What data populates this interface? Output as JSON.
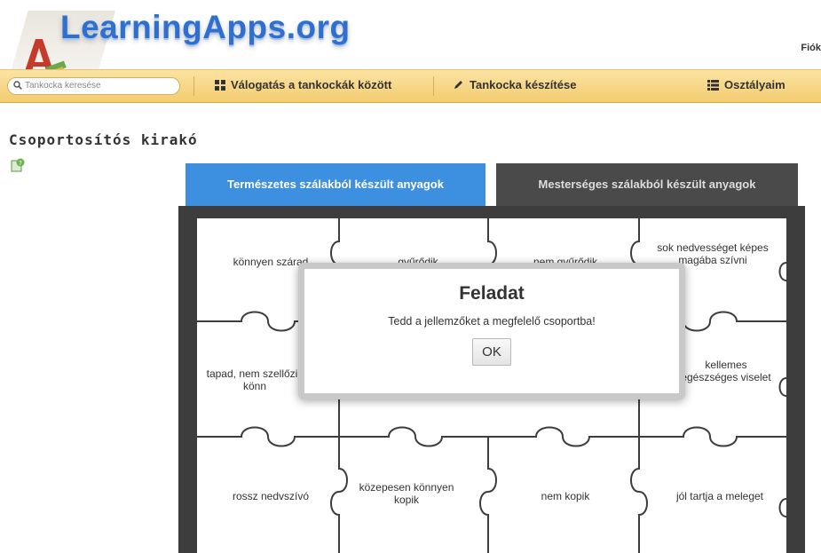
{
  "header": {
    "logo_text": "LearningApps.org",
    "account_label": "Fiók"
  },
  "toolbar": {
    "search_placeholder": "Tankocka keresése",
    "browse_label": "Válogatás a tankockák között",
    "create_label": "Tankocka készítése",
    "classes_label": "Osztályaim"
  },
  "page": {
    "title": "Csoportosítós kirakó"
  },
  "tabs": [
    {
      "label": "Természetes szálakból készült anyagok",
      "active": true
    },
    {
      "label": "Mesterséges szálakból készült anyagok",
      "active": false
    }
  ],
  "pieces": {
    "row1": [
      "könnyen szárad",
      "gyűrődik",
      "nem gyűrődik",
      "sok nedvességet képes magába szívni"
    ],
    "row2": [
      "tapad, nem szellőzik könn",
      "kellemes egészséges viselet"
    ],
    "row3": [
      "rossz nedvszívó",
      "közepesen könnyen kopik",
      "nem kopik",
      "jól tartja a meleget"
    ]
  },
  "dialog": {
    "title": "Feladat",
    "message": "Tedd a jellemzőket a megfelelő csoportba!",
    "ok_label": "OK"
  },
  "colors": {
    "active_tab": "#3d8fe0",
    "inactive_tab": "#4a4a4a",
    "toolbar": "#f3cc6f",
    "board": "#3d3d3d"
  }
}
